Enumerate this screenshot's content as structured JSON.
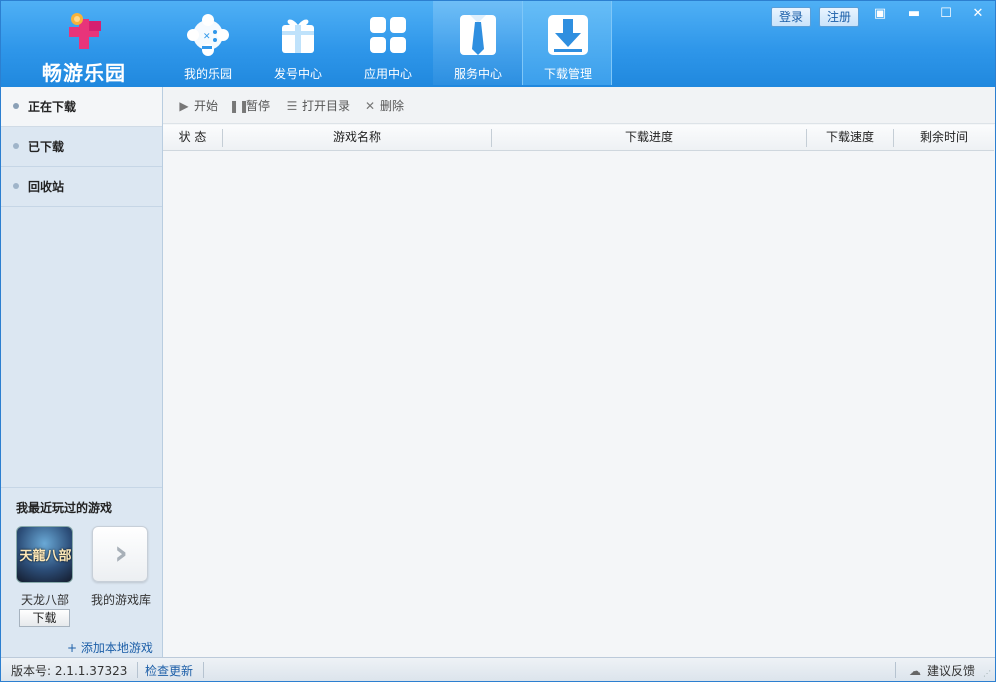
{
  "app": {
    "logo_text": "畅游乐园"
  },
  "nav": {
    "tabs": [
      {
        "label": "我的乐园",
        "icon": "gamepad-icon"
      },
      {
        "label": "发号中心",
        "icon": "gift-icon"
      },
      {
        "label": "应用中心",
        "icon": "apps-grid-icon"
      },
      {
        "label": "服务中心",
        "icon": "tie-icon"
      },
      {
        "label": "下载管理",
        "icon": "download-icon"
      }
    ],
    "active_tab": "下载管理"
  },
  "window": {
    "login_label": "登录",
    "register_label": "注册",
    "menu_glyph": "▣",
    "minimize_glyph": "▬",
    "maximize_glyph": "☐",
    "close_glyph": "✕"
  },
  "sidebar": {
    "items": [
      {
        "label": "正在下载",
        "active": true
      },
      {
        "label": "已下载",
        "active": false
      },
      {
        "label": "回收站",
        "active": false
      }
    ],
    "recent": {
      "title": "我最近玩过的游戏",
      "game": {
        "name": "天龙八部",
        "thumb_text": "天龍八部",
        "download_label": "下载"
      },
      "library": {
        "name": "我的游戏库",
        "chevron": "›"
      },
      "add_local_label": "+ 添加本地游戏"
    }
  },
  "toolbar": {
    "start_label": "开始",
    "start_icon": "▶",
    "pause_label": "暂停",
    "pause_icon": "❚❚",
    "open_dir_label": "打开目录",
    "open_dir_icon": "☰",
    "delete_label": "删除",
    "delete_icon": "✕"
  },
  "table": {
    "columns": [
      "状 态",
      "游戏名称",
      "下载进度",
      "下载速度",
      "剩余时间"
    ],
    "rows": []
  },
  "statusbar": {
    "version": "版本号: 2.1.1.37323",
    "check_update_label": "检查更新",
    "feedback_label": "建议反馈",
    "feedback_icon": "☁"
  },
  "colors": {
    "header_blue": "#2f97ea",
    "link_blue": "#1d5fa8",
    "logo_pink": "#e8347a"
  }
}
